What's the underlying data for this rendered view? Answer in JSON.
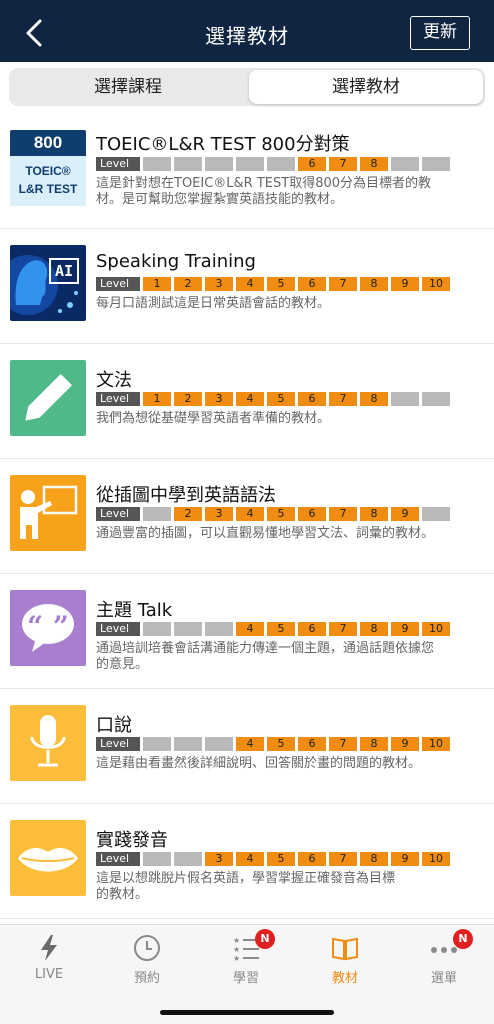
{
  "header": {
    "title": "選擇教材",
    "update_label": "更新",
    "back_icon": "chevron-left-icon"
  },
  "tabs": [
    {
      "label": "選擇課程",
      "selected": false
    },
    {
      "label": "選擇教材",
      "selected": true
    }
  ],
  "level_tag": "Level",
  "level_numbers": [
    "1",
    "2",
    "3",
    "4",
    "5",
    "6",
    "7",
    "8",
    "9",
    "10"
  ],
  "accent_color": "#f08c12",
  "materials": [
    {
      "title": "TOEIC®L&R TEST 800分對策",
      "icon": "toeic-800-icon",
      "thumb_text_top": "800",
      "thumb_text_l1": "TOEIC®",
      "thumb_text_l2": "L&R TEST",
      "levels_on": [
        6,
        7,
        8
      ],
      "desc_lines": [
        "這是針對想在TOEIC®L&R TEST取得800分為目標者的教",
        "材。是可幫助您掌握紮實英語技能的教材。"
      ]
    },
    {
      "title": "Speaking Training",
      "icon": "ai-head-icon",
      "thumb_text_top": "AI",
      "levels_on": [
        1,
        2,
        3,
        4,
        5,
        6,
        7,
        8,
        9,
        10
      ],
      "desc_lines": [
        "每月口語測試這是日常英語會話的教材。"
      ]
    },
    {
      "title": "文法",
      "icon": "pencil-icon",
      "levels_on": [
        1,
        2,
        3,
        4,
        5,
        6,
        7,
        8
      ],
      "desc_lines": [
        "我們為想從基礎學習英語者準備的教材。"
      ]
    },
    {
      "title": "從插圖中學到英語語法",
      "icon": "teacher-board-icon",
      "levels_on": [
        2,
        3,
        4,
        5,
        6,
        7,
        8,
        9
      ],
      "desc_lines": [
        "通過豐富的插圖，可以直觀易懂地學習文法、詞彙的教材。"
      ]
    },
    {
      "title": "主題 Talk",
      "icon": "speech-bubble-quote-icon",
      "levels_on": [
        4,
        5,
        6,
        7,
        8,
        9,
        10
      ],
      "desc_lines": [
        "通過培訓培養會話溝通能力傳達一個主題，通過話題依據您",
        "的意見。"
      ]
    },
    {
      "title": "口說",
      "icon": "microphone-icon",
      "levels_on": [
        4,
        5,
        6,
        7,
        8,
        9,
        10
      ],
      "desc_lines": [
        "這是藉由看畫然後詳細說明、回答關於畫的問題的教材。"
      ]
    },
    {
      "title": "實踐發音",
      "icon": "lips-icon",
      "levels_on": [
        3,
        4,
        5,
        6,
        7,
        8,
        9,
        10
      ],
      "desc_lines": [
        "這是以想跳脫片假名英語，學習掌握正確發音為目標",
        "的教材。"
      ]
    }
  ],
  "bottom_nav": [
    {
      "label": "LIVE",
      "icon": "lightning-icon",
      "active": false,
      "badge": ""
    },
    {
      "label": "預約",
      "icon": "clock-icon",
      "active": false,
      "badge": ""
    },
    {
      "label": "學習",
      "icon": "list-stars-icon",
      "active": false,
      "badge": "N"
    },
    {
      "label": "教材",
      "icon": "open-book-icon",
      "active": true,
      "badge": ""
    },
    {
      "label": "選單",
      "icon": "more-dots-icon",
      "active": false,
      "badge": "N"
    }
  ]
}
